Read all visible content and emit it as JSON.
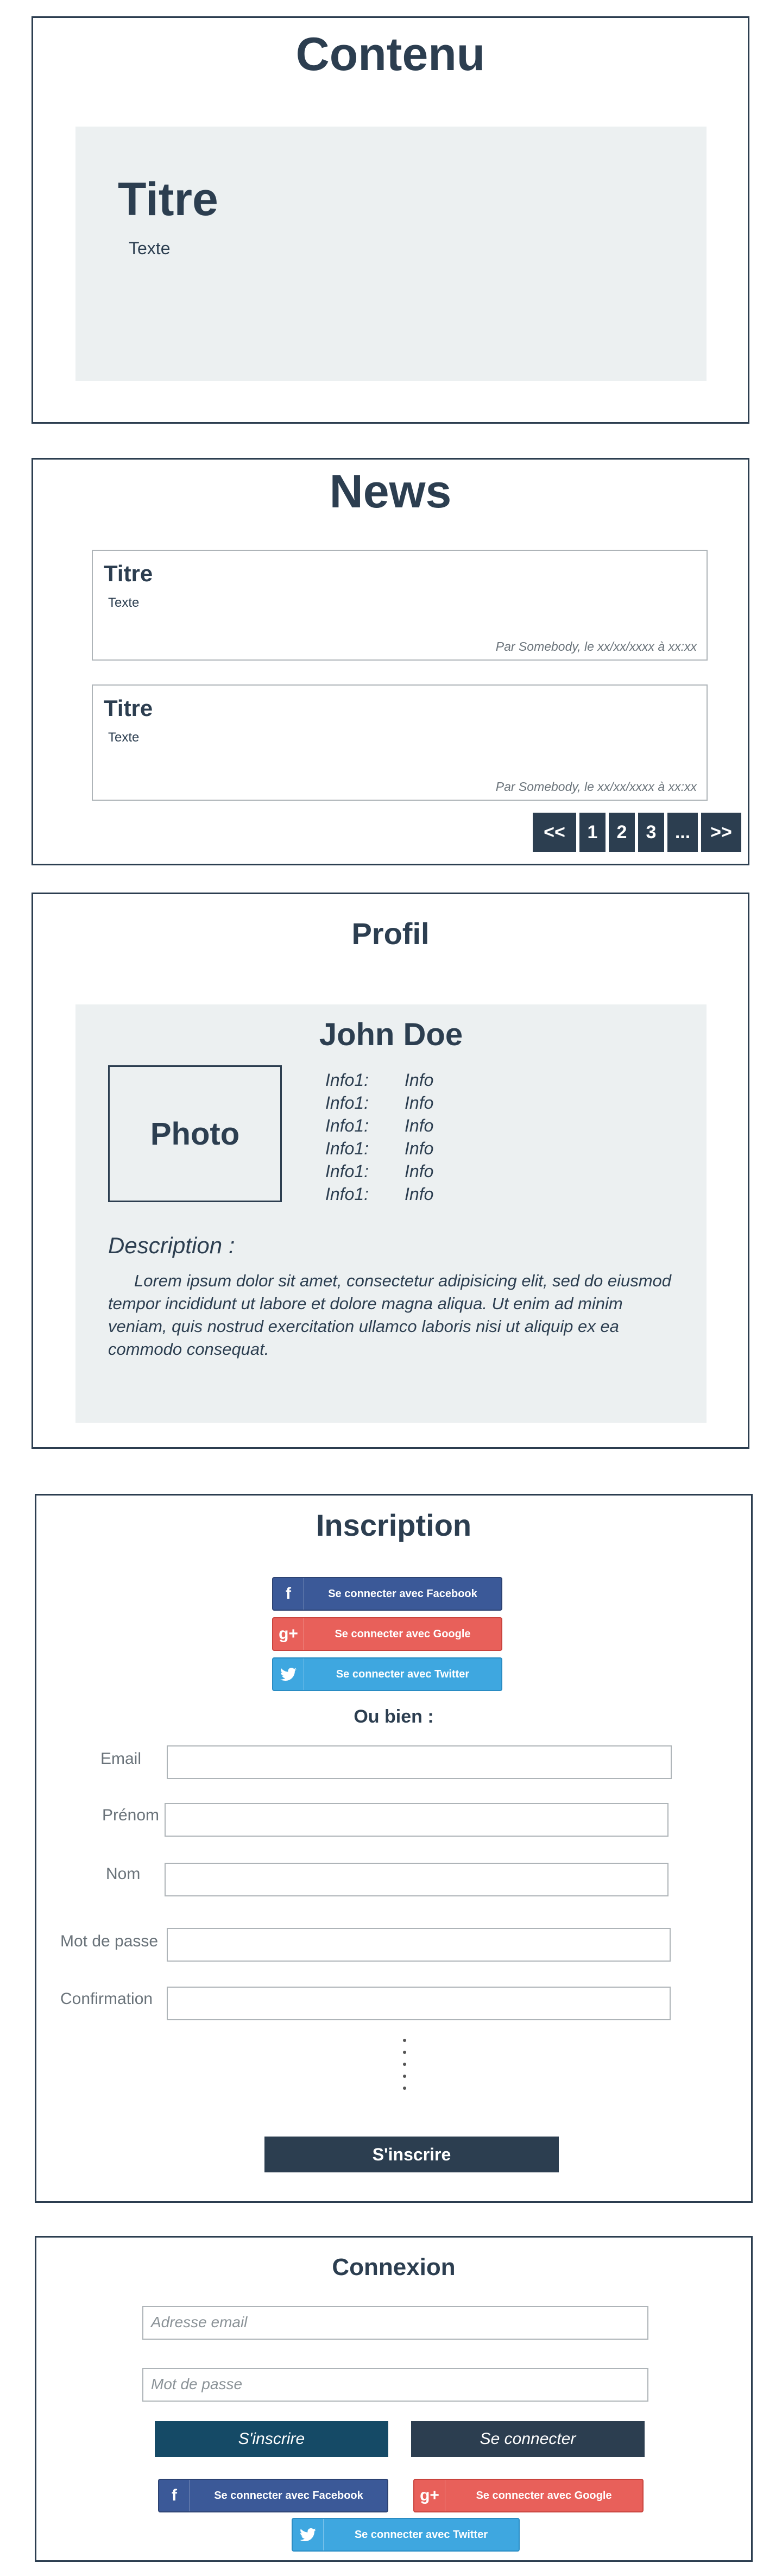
{
  "contenu": {
    "heading": "Contenu",
    "title": "Titre",
    "text": "Texte"
  },
  "news": {
    "heading": "News",
    "items": [
      {
        "title": "Titre",
        "text": "Texte",
        "meta": "Par Somebody, le xx/xx/xxxx à xx:xx"
      },
      {
        "title": "Titre",
        "text": "Texte",
        "meta": "Par Somebody, le xx/xx/xxxx à xx:xx"
      }
    ],
    "pagination": {
      "first": "<<",
      "p1": "1",
      "p2": "2",
      "p3": "3",
      "more": "...",
      "last": ">>"
    }
  },
  "profil": {
    "heading": "Profil",
    "name": "John Doe",
    "photo": "Photo",
    "infos": [
      {
        "key": "Info1:",
        "value": "Info"
      },
      {
        "key": "Info1:",
        "value": "Info"
      },
      {
        "key": "Info1:",
        "value": "Info"
      },
      {
        "key": "Info1:",
        "value": "Info"
      },
      {
        "key": "Info1:",
        "value": "Info"
      },
      {
        "key": "Info1:",
        "value": "Info"
      }
    ],
    "description_heading": "Description :",
    "description": "Lorem ipsum dolor sit amet, consectetur adipisicing elit, sed do eiusmod tempor incididunt ut labore et dolore magna aliqua. Ut enim ad minim veniam, quis nostrud exercitation ullamco laboris nisi ut aliquip ex ea commodo consequat."
  },
  "inscription": {
    "heading": "Inscription",
    "facebook": "Se connecter avec Facebook",
    "google": "Se connecter avec Google",
    "twitter": "Se connecter avec Twitter",
    "or": "Ou bien :",
    "fields": {
      "email": "Email",
      "prenom": "Prénom",
      "nom": "Nom",
      "password": "Mot de passe",
      "confirm": "Confirmation"
    },
    "submit": "S'inscrire"
  },
  "connexion": {
    "heading": "Connexion",
    "email_placeholder": "Adresse email",
    "password_placeholder": "Mot de passe",
    "signup": "S'inscrire",
    "login": "Se connecter",
    "facebook": "Se connecter avec Facebook",
    "google": "Se connecter avec Google",
    "twitter": "Se connecter avec Twitter"
  },
  "colors": {
    "primary": "#2c3e50",
    "panel": "#ecf0f1",
    "signup_button": "#154a66",
    "facebook": "#3b5998",
    "google": "#e8605a",
    "twitter": "#3ea7e0"
  }
}
